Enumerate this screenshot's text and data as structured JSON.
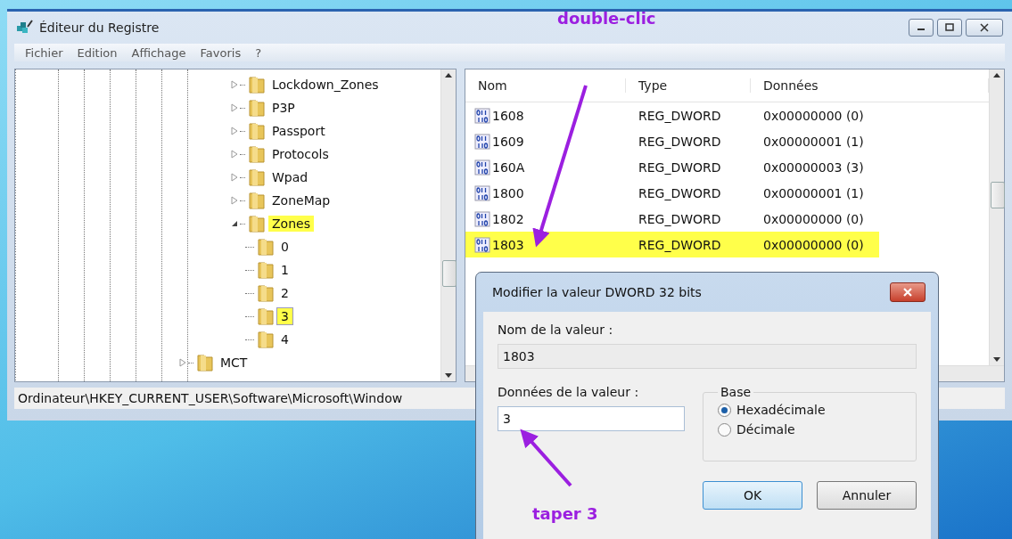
{
  "window": {
    "title": "Éditeur du Registre"
  },
  "menu": [
    "Fichier",
    "Edition",
    "Affichage",
    "Favoris",
    "?"
  ],
  "tree": {
    "items": [
      {
        "label": "Lockdown_Zones",
        "expanded": false,
        "selected": false,
        "highlighted": false
      },
      {
        "label": "P3P",
        "expanded": false,
        "selected": false,
        "highlighted": false
      },
      {
        "label": "Passport",
        "expanded": false,
        "selected": false,
        "highlighted": false
      },
      {
        "label": "Protocols",
        "expanded": false,
        "selected": false,
        "highlighted": false
      },
      {
        "label": "Wpad",
        "expanded": false,
        "selected": false,
        "highlighted": false
      },
      {
        "label": "ZoneMap",
        "expanded": false,
        "selected": false,
        "highlighted": false
      },
      {
        "label": "Zones",
        "expanded": true,
        "selected": false,
        "highlighted": true,
        "children": [
          {
            "label": "0",
            "selected": false,
            "highlighted": false
          },
          {
            "label": "1",
            "selected": false,
            "highlighted": false
          },
          {
            "label": "2",
            "selected": false,
            "highlighted": false
          },
          {
            "label": "3",
            "selected": true,
            "highlighted": true
          },
          {
            "label": "4",
            "selected": false,
            "highlighted": false
          }
        ]
      }
    ],
    "after": [
      {
        "label": "MCT",
        "expanded": false,
        "selected": false,
        "highlighted": false
      }
    ]
  },
  "table": {
    "columns": [
      "Nom",
      "Type",
      "Données"
    ],
    "rows": [
      {
        "name": "1608",
        "type": "REG_DWORD",
        "data": "0x00000000 (0)",
        "highlighted": false
      },
      {
        "name": "1609",
        "type": "REG_DWORD",
        "data": "0x00000001 (1)",
        "highlighted": false
      },
      {
        "name": "160A",
        "type": "REG_DWORD",
        "data": "0x00000003 (3)",
        "highlighted": false
      },
      {
        "name": "1800",
        "type": "REG_DWORD",
        "data": "0x00000001 (1)",
        "highlighted": false
      },
      {
        "name": "1802",
        "type": "REG_DWORD",
        "data": "0x00000000 (0)",
        "highlighted": false
      },
      {
        "name": "1803",
        "type": "REG_DWORD",
        "data": "0x00000000 (0)",
        "highlighted": true
      }
    ]
  },
  "status_bar": "Ordinateur\\HKEY_CURRENT_USER\\Software\\Microsoft\\Window",
  "dialog": {
    "title": "Modifier la valeur DWORD 32 bits",
    "name_label": "Nom de la valeur :",
    "name_value": "1803",
    "data_label": "Données de la valeur :",
    "data_value": "3",
    "base_label": "Base",
    "bases": [
      {
        "label": "Hexadécimale",
        "selected": true
      },
      {
        "label": "Décimale",
        "selected": false
      }
    ],
    "buttons": [
      {
        "label": "OK",
        "default": true
      },
      {
        "label": "Annuler",
        "default": false
      }
    ]
  },
  "annotations": [
    {
      "text": "double-clic"
    },
    {
      "text": "taper 3"
    }
  ]
}
